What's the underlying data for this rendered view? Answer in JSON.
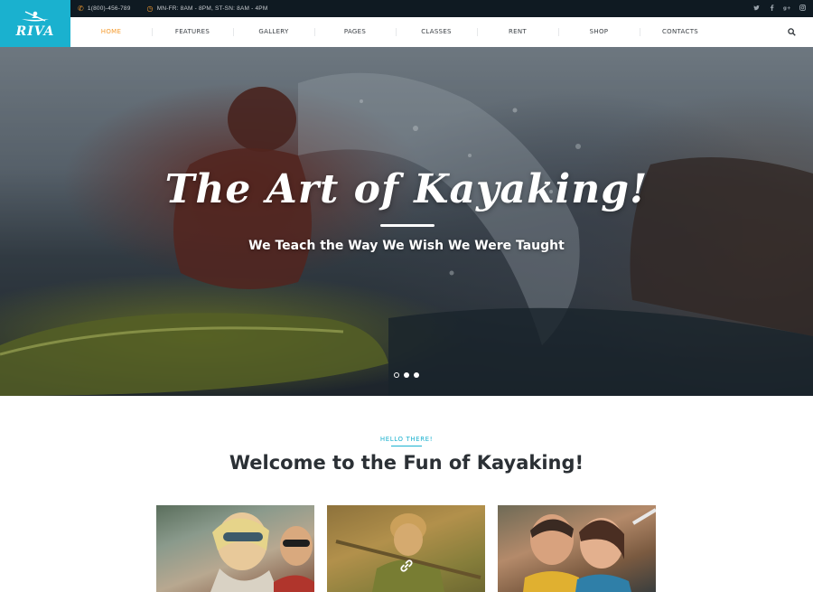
{
  "logo": {
    "text": "RIVA"
  },
  "topbar": {
    "phone": "1(800)-456-789",
    "hours": "MN-FR: 8AM - 8PM, ST-SN: 8AM - 4PM",
    "socials": [
      "twitter-icon",
      "facebook-icon",
      "google-plus-icon",
      "instagram-icon"
    ]
  },
  "nav": {
    "items": [
      {
        "label": "HOME",
        "active": true
      },
      {
        "label": "FEATURES"
      },
      {
        "label": "GALLERY"
      },
      {
        "label": "PAGES"
      },
      {
        "label": "CLASSES"
      },
      {
        "label": "RENT"
      },
      {
        "label": "SHOP"
      },
      {
        "label": "CONTACTS"
      }
    ]
  },
  "hero": {
    "title": "The Art of Kayaking!",
    "subtitle": "We Teach the Way We Wish We Were Taught",
    "slides": 3,
    "active_slide": 1
  },
  "welcome": {
    "eyebrow": "HELLO THERE!",
    "heading": "Welcome to the Fun of Kayaking!"
  },
  "colors": {
    "accent": "#1ab1cf",
    "active_nav": "#f59b2e",
    "topbar": "#0f1a22"
  }
}
